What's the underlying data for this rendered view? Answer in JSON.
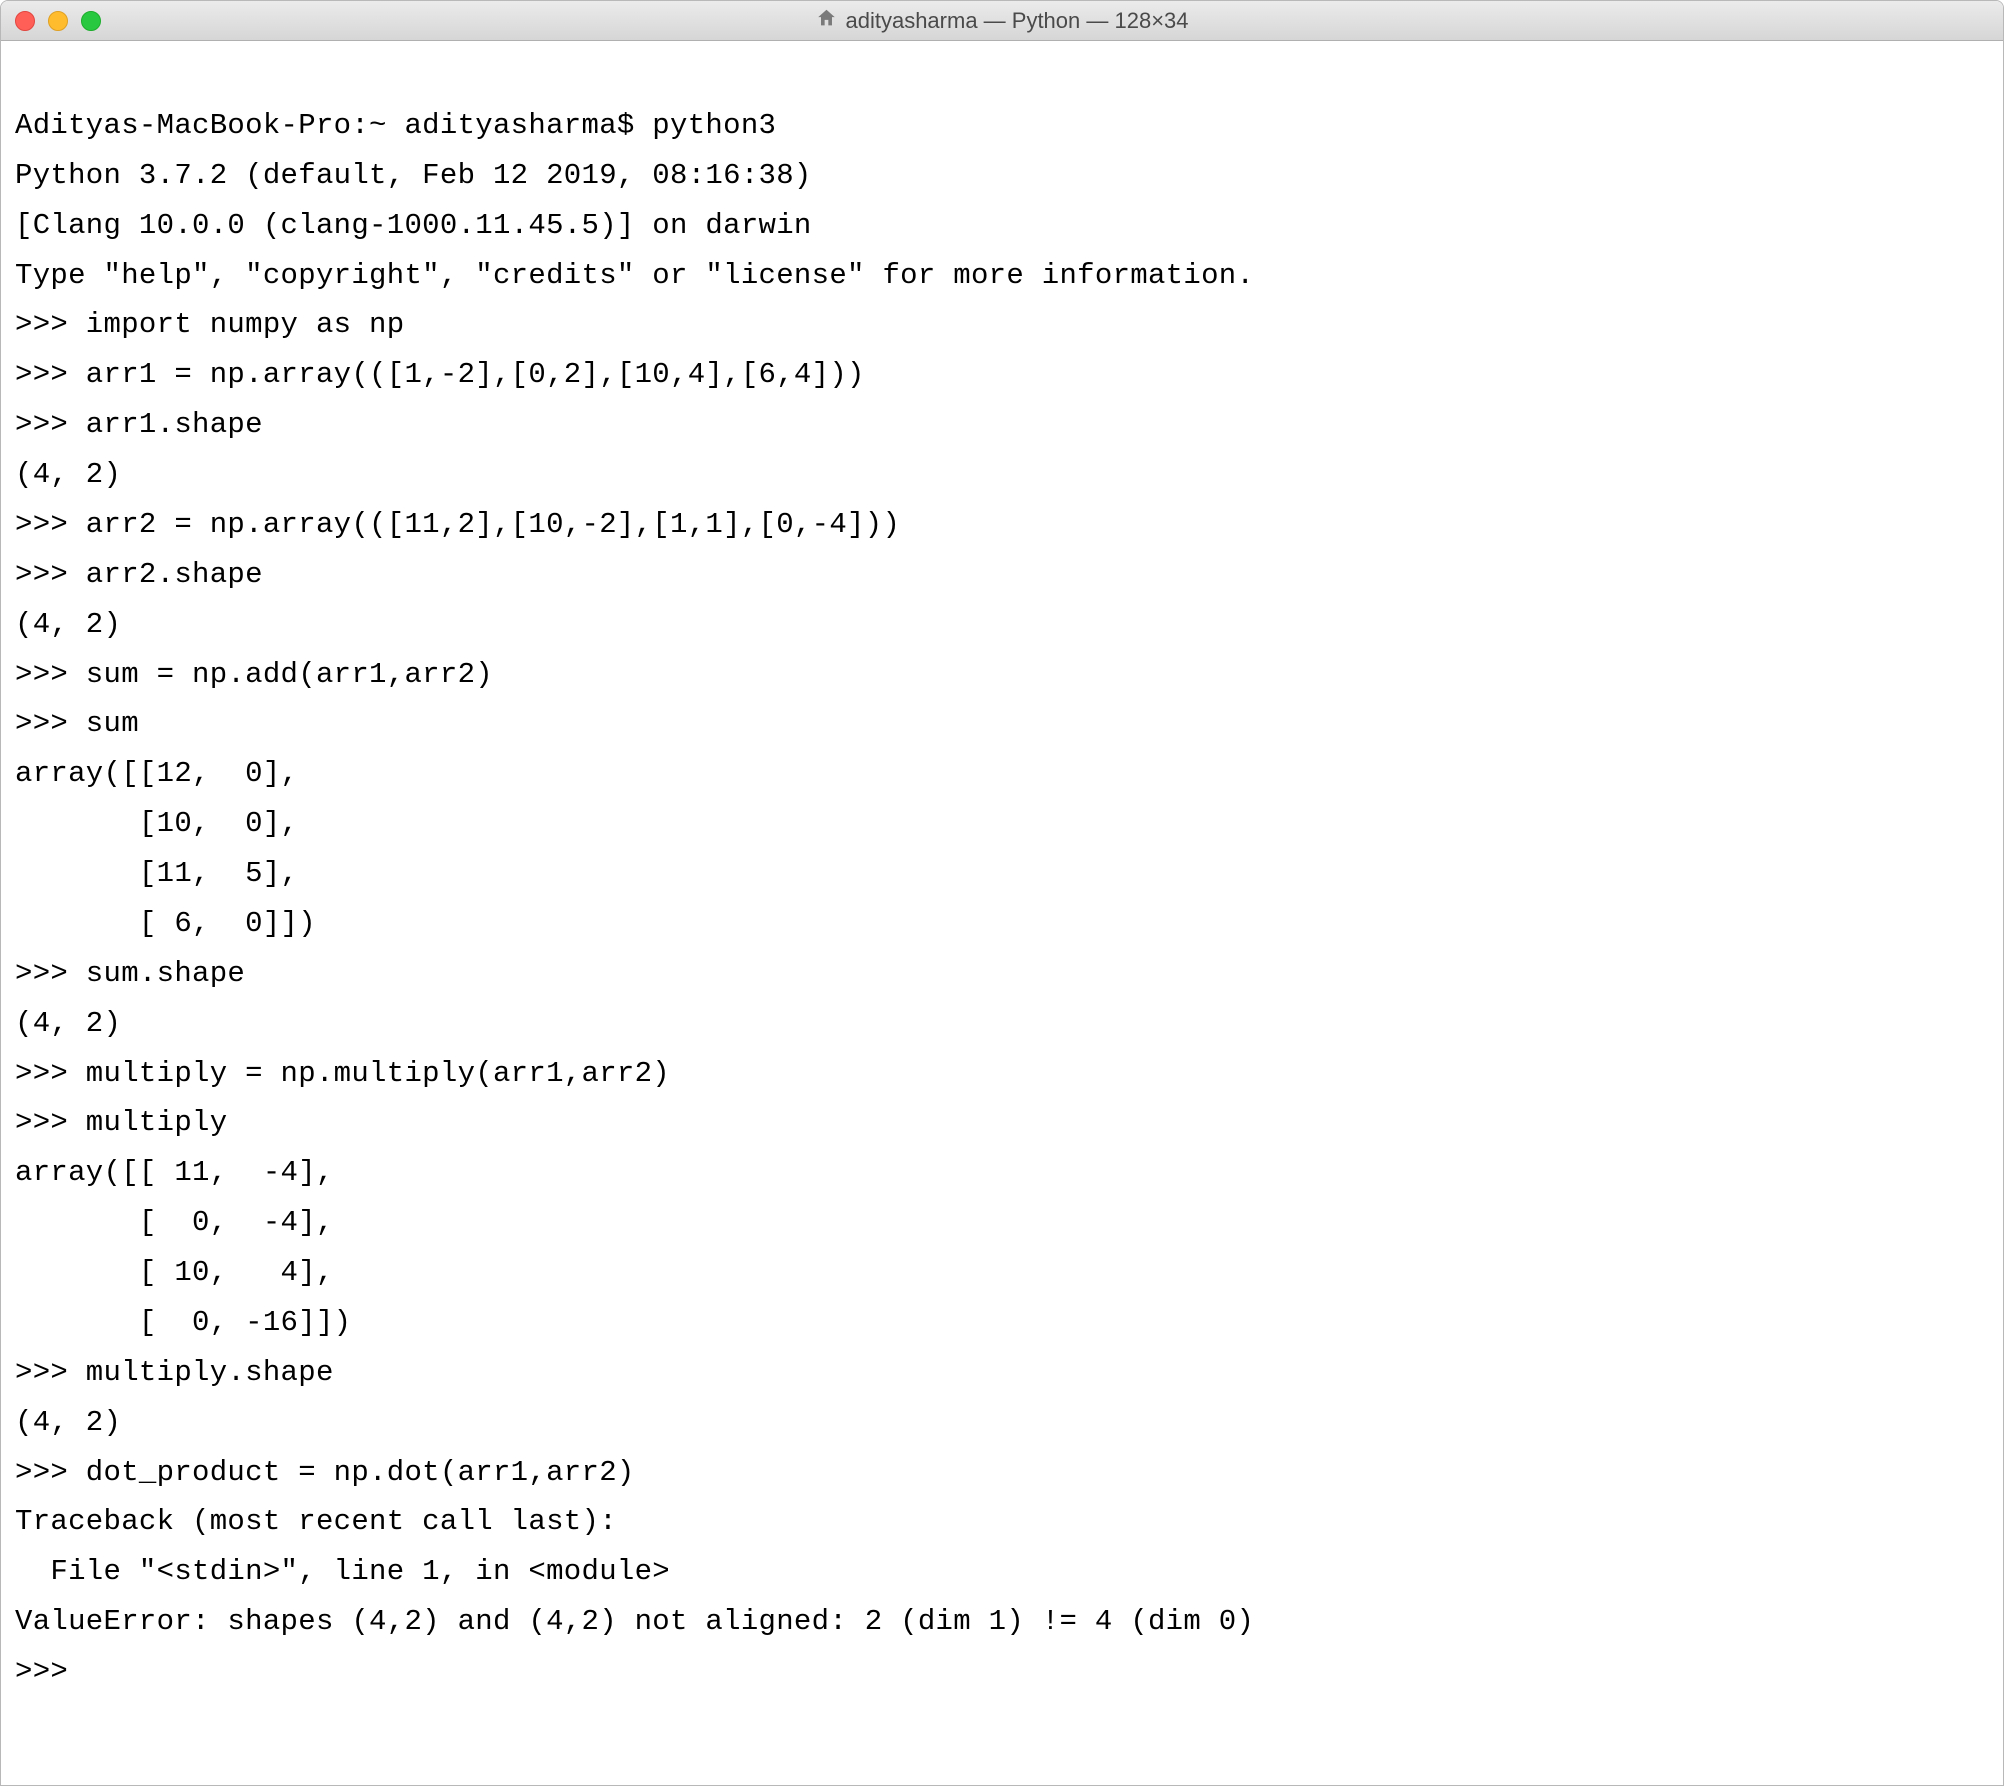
{
  "window": {
    "title": "adityasharma — Python — 128×34"
  },
  "terminal": {
    "lines": [
      "Adityas-MacBook-Pro:~ adityasharma$ python3",
      "Python 3.7.2 (default, Feb 12 2019, 08:16:38)",
      "[Clang 10.0.0 (clang-1000.11.45.5)] on darwin",
      "Type \"help\", \"copyright\", \"credits\" or \"license\" for more information.",
      ">>> import numpy as np",
      ">>> arr1 = np.array(([1,-2],[0,2],[10,4],[6,4]))",
      ">>> arr1.shape",
      "(4, 2)",
      ">>> arr2 = np.array(([11,2],[10,-2],[1,1],[0,-4]))",
      ">>> arr2.shape",
      "(4, 2)",
      ">>> sum = np.add(arr1,arr2)",
      ">>> sum",
      "array([[12,  0],",
      "       [10,  0],",
      "       [11,  5],",
      "       [ 6,  0]])",
      ">>> sum.shape",
      "(4, 2)",
      ">>> multiply = np.multiply(arr1,arr2)",
      ">>> multiply",
      "array([[ 11,  -4],",
      "       [  0,  -4],",
      "       [ 10,   4],",
      "       [  0, -16]])",
      ">>> multiply.shape",
      "(4, 2)",
      ">>> dot_product = np.dot(arr1,arr2)",
      "Traceback (most recent call last):",
      "  File \"<stdin>\", line 1, in <module>",
      "ValueError: shapes (4,2) and (4,2) not aligned: 2 (dim 1) != 4 (dim 0)",
      ">>> "
    ]
  }
}
